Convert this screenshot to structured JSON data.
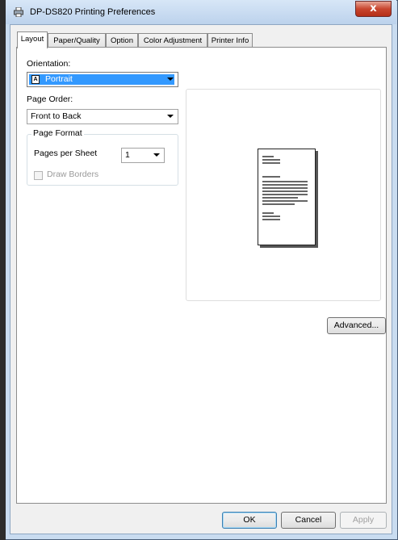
{
  "window": {
    "title": "DP-DS820 Printing Preferences",
    "close_label": "x"
  },
  "tabs": [
    {
      "label": "Layout",
      "active": true
    },
    {
      "label": "Paper/Quality",
      "active": false
    },
    {
      "label": "Option",
      "active": false
    },
    {
      "label": "Color Adjustment",
      "active": false
    },
    {
      "label": "Printer Info",
      "active": false
    }
  ],
  "layout": {
    "orientation_label": "Orientation:",
    "orientation_value": "Portrait",
    "orientation_icon_letter": "A",
    "page_order_label": "Page Order:",
    "page_order_value": "Front to Back",
    "page_format": {
      "title": "Page Format",
      "pages_per_sheet_label": "Pages per Sheet",
      "pages_per_sheet_value": "1",
      "draw_borders_label": "Draw Borders",
      "draw_borders_checked": false,
      "draw_borders_enabled": false
    },
    "advanced_label": "Advanced..."
  },
  "footer": {
    "ok_label": "OK",
    "cancel_label": "Cancel",
    "apply_label": "Apply"
  },
  "colors": {
    "selection": "#3399ff",
    "close_button": "#c8462f",
    "frame": "#c9dcf0"
  }
}
